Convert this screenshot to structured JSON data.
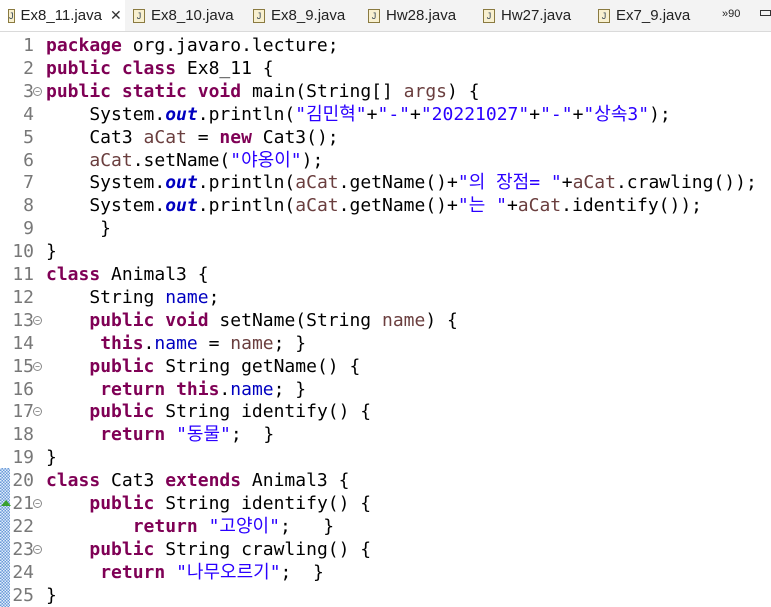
{
  "tabs": [
    {
      "label": "Ex8_11.java",
      "active": true
    },
    {
      "label": "Ex8_10.java"
    },
    {
      "label": "Ex8_9.java"
    },
    {
      "label": "Hw28.java"
    },
    {
      "label": "Hw27.java"
    },
    {
      "label": "Ex7_9.java"
    }
  ],
  "more_tabs": "»90",
  "lines": [
    {
      "n": "1",
      "t": [
        [
          "kw",
          "package"
        ],
        [
          "p",
          " org.javaro.lecture;"
        ]
      ]
    },
    {
      "n": "2",
      "t": [
        [
          "kw",
          "public"
        ],
        [
          "p",
          " "
        ],
        [
          "kw",
          "class"
        ],
        [
          "p",
          " Ex8_11 {"
        ]
      ]
    },
    {
      "n": "3",
      "fold": true,
      "t": [
        [
          "kw",
          "public"
        ],
        [
          "p",
          " "
        ],
        [
          "kw",
          "static"
        ],
        [
          "p",
          " "
        ],
        [
          "kw",
          "void"
        ],
        [
          "p",
          " main(String[] "
        ],
        [
          "lv",
          "args"
        ],
        [
          "p",
          ") {"
        ]
      ]
    },
    {
      "n": "4",
      "t": [
        [
          "p",
          "    System."
        ],
        [
          "sf",
          "out"
        ],
        [
          "p",
          ".println("
        ],
        [
          "str",
          "\"김민혁\""
        ],
        [
          "p",
          "+"
        ],
        [
          "str",
          "\"-\""
        ],
        [
          "p",
          "+"
        ],
        [
          "str",
          "\"20221027\""
        ],
        [
          "p",
          "+"
        ],
        [
          "str",
          "\"-\""
        ],
        [
          "p",
          "+"
        ],
        [
          "str",
          "\"상속3\""
        ],
        [
          "p",
          ");"
        ]
      ]
    },
    {
      "n": "5",
      "t": [
        [
          "p",
          "    Cat3 "
        ],
        [
          "lv",
          "aCat"
        ],
        [
          "p",
          " = "
        ],
        [
          "kw",
          "new"
        ],
        [
          "p",
          " Cat3();"
        ]
      ]
    },
    {
      "n": "6",
      "t": [
        [
          "p",
          "    "
        ],
        [
          "lv",
          "aCat"
        ],
        [
          "p",
          ".setName("
        ],
        [
          "str",
          "\"야옹이\""
        ],
        [
          "p",
          ");"
        ]
      ]
    },
    {
      "n": "7",
      "t": [
        [
          "p",
          "    System."
        ],
        [
          "sf",
          "out"
        ],
        [
          "p",
          ".println("
        ],
        [
          "lv",
          "aCat"
        ],
        [
          "p",
          ".getName()+"
        ],
        [
          "str",
          "\"의 장점= \""
        ],
        [
          "p",
          "+"
        ],
        [
          "lv",
          "aCat"
        ],
        [
          "p",
          ".crawling());"
        ]
      ]
    },
    {
      "n": "8",
      "t": [
        [
          "p",
          "    System."
        ],
        [
          "sf",
          "out"
        ],
        [
          "p",
          ".println("
        ],
        [
          "lv",
          "aCat"
        ],
        [
          "p",
          ".getName()+"
        ],
        [
          "str",
          "\"는 \""
        ],
        [
          "p",
          "+"
        ],
        [
          "lv",
          "aCat"
        ],
        [
          "p",
          ".identify());"
        ]
      ]
    },
    {
      "n": "9",
      "t": [
        [
          "p",
          "     }"
        ]
      ]
    },
    {
      "n": "10",
      "t": [
        [
          "p",
          "}"
        ]
      ]
    },
    {
      "n": "11",
      "t": [
        [
          "kw",
          "class"
        ],
        [
          "p",
          " Animal3 {"
        ]
      ]
    },
    {
      "n": "12",
      "t": [
        [
          "p",
          "    String "
        ],
        [
          "fld",
          "name"
        ],
        [
          "p",
          ";"
        ]
      ]
    },
    {
      "n": "13",
      "fold": true,
      "t": [
        [
          "p",
          "    "
        ],
        [
          "kw",
          "public"
        ],
        [
          "p",
          " "
        ],
        [
          "kw",
          "void"
        ],
        [
          "p",
          " setName(String "
        ],
        [
          "lv",
          "name"
        ],
        [
          "p",
          ") {"
        ]
      ]
    },
    {
      "n": "14",
      "t": [
        [
          "p",
          "     "
        ],
        [
          "kw",
          "this"
        ],
        [
          "p",
          "."
        ],
        [
          "fld",
          "name"
        ],
        [
          "p",
          " = "
        ],
        [
          "lv",
          "name"
        ],
        [
          "p",
          "; }"
        ]
      ]
    },
    {
      "n": "15",
      "fold": true,
      "t": [
        [
          "p",
          "    "
        ],
        [
          "kw",
          "public"
        ],
        [
          "p",
          " String getName() {"
        ]
      ]
    },
    {
      "n": "16",
      "t": [
        [
          "p",
          "     "
        ],
        [
          "kw",
          "return"
        ],
        [
          "p",
          " "
        ],
        [
          "kw",
          "this"
        ],
        [
          "p",
          "."
        ],
        [
          "fld",
          "name"
        ],
        [
          "p",
          "; }"
        ]
      ]
    },
    {
      "n": "17",
      "fold": true,
      "t": [
        [
          "p",
          "    "
        ],
        [
          "kw",
          "public"
        ],
        [
          "p",
          " String identify() {"
        ]
      ]
    },
    {
      "n": "18",
      "t": [
        [
          "p",
          "     "
        ],
        [
          "kw",
          "return"
        ],
        [
          "p",
          " "
        ],
        [
          "str",
          "\"동물\""
        ],
        [
          "p",
          ";  }"
        ]
      ]
    },
    {
      "n": "19",
      "t": [
        [
          "p",
          "}"
        ]
      ]
    },
    {
      "n": "20",
      "t": [
        [
          "kw",
          "class"
        ],
        [
          "p",
          " Cat3 "
        ],
        [
          "kw",
          "extends"
        ],
        [
          "p",
          " Animal3 {"
        ]
      ]
    },
    {
      "n": "21",
      "fold": true,
      "t": [
        [
          "p",
          "    "
        ],
        [
          "kw",
          "public"
        ],
        [
          "p",
          " String identify() {"
        ]
      ]
    },
    {
      "n": "22",
      "t": [
        [
          "p",
          "        "
        ],
        [
          "kw",
          "return"
        ],
        [
          "p",
          " "
        ],
        [
          "str",
          "\"고양이\""
        ],
        [
          "p",
          ";   }"
        ]
      ]
    },
    {
      "n": "23",
      "fold": true,
      "t": [
        [
          "p",
          "    "
        ],
        [
          "kw",
          "public"
        ],
        [
          "p",
          " String crawling() {"
        ]
      ]
    },
    {
      "n": "24",
      "t": [
        [
          "p",
          "     "
        ],
        [
          "kw",
          "return"
        ],
        [
          "p",
          " "
        ],
        [
          "str",
          "\"나무오르기\""
        ],
        [
          "p",
          ";  }"
        ]
      ]
    },
    {
      "n": "25",
      "t": [
        [
          "p",
          "}"
        ]
      ]
    }
  ]
}
